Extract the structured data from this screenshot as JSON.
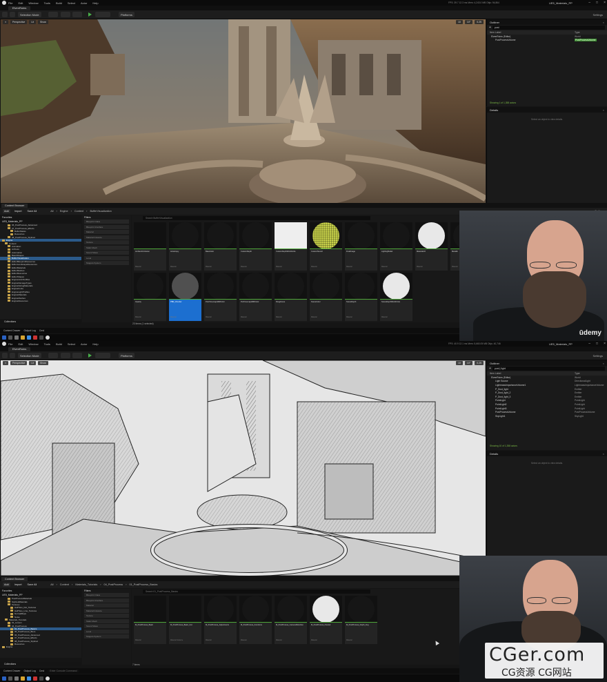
{
  "menu": {
    "items": [
      "File",
      "Edit",
      "Window",
      "Tools",
      "Build",
      "Select",
      "Actor",
      "Help"
    ],
    "project_name": "UE5_Materials_PP",
    "stats_top": "FPS: 39.7    12.3 ms    Mem: 4,243.0 MB    Objs: 94,864",
    "stats_bottom": "FPS: 40.9    12.1 ms    Mem: 5,660.05 MB    Objs: 40,746"
  },
  "level_tab": "ElvenRuins",
  "toolbar": {
    "mode": "Selection Mode",
    "platforms": "Platforms",
    "settings": "Settings"
  },
  "viewport": {
    "perspective": "Perspective",
    "lit": "Lit",
    "show": "Show",
    "grid_value": "10",
    "angle_value": "10°",
    "scale_value": "0.25"
  },
  "outliner_top": {
    "title": "Outliner",
    "search": "post",
    "col_label": "Item Label",
    "col_type": "Type",
    "rows": [
      {
        "label": "ElvenRuins (Editor)",
        "type": "World"
      },
      {
        "label": "PostProcessVolume",
        "type": "PostProcessVolume"
      }
    ],
    "footer": "Showing 1 of 1,358 actors"
  },
  "outliner_bottom": {
    "title": "Outliner",
    "search": "post | light",
    "col_label": "Item Label",
    "col_type": "Type",
    "rows": [
      {
        "label": "ElvenRuins (Editor)",
        "type": "World"
      },
      {
        "label": "Light Source",
        "type": "DirectionalLight"
      },
      {
        "label": "LightmassImportanceVolume1",
        "type": "LightmassImportanceVolume"
      },
      {
        "label": "P_Dust_light",
        "type": "Emitter"
      },
      {
        "label": "P_Dust_light_2",
        "type": "Emitter"
      },
      {
        "label": "P_Dust_light_3",
        "type": "Emitter"
      },
      {
        "label": "PointLight",
        "type": "PointLight"
      },
      {
        "label": "PointLight2",
        "type": "PointLight"
      },
      {
        "label": "PointLight3",
        "type": "PointLight"
      },
      {
        "label": "PostProcessVolume",
        "type": "PostProcessVolume"
      },
      {
        "label": "SkyLight1",
        "type": "SkyLight"
      }
    ],
    "footer": "Showing 10 of 1,358 actors"
  },
  "details": {
    "title": "Details",
    "empty": "Select an object to view details."
  },
  "content_browser_top": {
    "tab": "Content Browser",
    "add": "Add",
    "import": "Import",
    "save_all": "Save All",
    "breadcrumb": [
      "All",
      "Engine",
      "Content",
      "BufferVisualization"
    ],
    "settings": "Settings",
    "search_placeholder": "Search BufferVisualization",
    "filters_title": "Filters",
    "filters": [
      "Blueprint Class",
      "Blueprint Interface",
      "Material",
      "Material Instance",
      "Texture",
      "Static Mesh",
      "Sound Wave",
      "Level",
      "Niagara System"
    ],
    "sources": [
      {
        "label": "Favorites",
        "depth": 0,
        "head": true
      },
      {
        "label": "UE5_Materials_PP",
        "depth": 0,
        "head": true
      },
      {
        "label": "06_PostProcess_Advanced",
        "depth": 2
      },
      {
        "label": "07_PostProcess_Effects",
        "depth": 2
      },
      {
        "label": "BufferMasks",
        "depth": 3
      },
      {
        "label": "Resources",
        "depth": 3
      },
      {
        "label": "08_PostProcess_Stylized",
        "depth": 2
      },
      {
        "label": "Engine",
        "depth": 0,
        "sel": true
      },
      {
        "label": "Content",
        "depth": 1
      },
      {
        "label": "Animation",
        "depth": 2
      },
      {
        "label": "ArtTools",
        "depth": 2
      },
      {
        "label": "Automation",
        "depth": 2
      },
      {
        "label": "BasicShapes",
        "depth": 2
      },
      {
        "label": "BufferVisualization",
        "depth": 2,
        "sel": true
      },
      {
        "label": "EditorBlueprintResources",
        "depth": 2
      },
      {
        "label": "EditorLandscapeResources",
        "depth": 2
      },
      {
        "label": "EditorMaterials",
        "depth": 2
      },
      {
        "label": "EditorMeshes",
        "depth": 2
      },
      {
        "label": "EditorResources",
        "depth": 2
      },
      {
        "label": "EditorShapes",
        "depth": 2
      },
      {
        "label": "EngineAnimNotifies",
        "depth": 2
      },
      {
        "label": "EngineDamageTypes",
        "depth": 2
      },
      {
        "label": "EngineDebugMaterials",
        "depth": 2
      },
      {
        "label": "EngineFonts",
        "depth": 2
      },
      {
        "label": "EngineLightProfiles",
        "depth": 2
      },
      {
        "label": "EngineMaterials",
        "depth": 2
      },
      {
        "label": "EngineMeshes",
        "depth": 2
      },
      {
        "label": "EngineResources",
        "depth": 2
      }
    ],
    "assets": [
      {
        "name": "AmbientOcclusion",
        "kind": "Material"
      },
      {
        "name": "Anisotropy",
        "kind": "Material"
      },
      {
        "name": "BaseColor",
        "kind": "Material"
      },
      {
        "name": "CustomDepth",
        "kind": "Material"
      },
      {
        "name": "CustomDepthWorldUnits",
        "kind": "Material"
      },
      {
        "name": "CustomStencil",
        "kind": "Material"
      },
      {
        "name": "FinalImage",
        "kind": "Material"
      },
      {
        "name": "LightingModel",
        "kind": "Material"
      },
      {
        "name": "MaterialAO",
        "kind": "Material"
      },
      {
        "name": "Metallic",
        "kind": "Material"
      },
      {
        "name": "Opacity",
        "kind": "Material"
      },
      {
        "name": "PBR_Checker",
        "kind": "Material"
      },
      {
        "name": "PostTonemapHDRColor",
        "kind": "Material"
      },
      {
        "name": "PreTonemapHDRColor",
        "kind": "Material"
      },
      {
        "name": "Roughness",
        "kind": "Material"
      },
      {
        "name": "SceneColor",
        "kind": "Material"
      },
      {
        "name": "SceneDepth",
        "kind": "Material"
      },
      {
        "name": "SceneDepthWorldUnits",
        "kind": "Material"
      }
    ],
    "item_count": "23 items (1 selected)",
    "collections": "Collections"
  },
  "content_browser_bottom": {
    "tab": "Content Browser",
    "add": "Add",
    "import": "Import",
    "save_all": "Save All",
    "breadcrumb": [
      "All",
      "Content",
      "Materials_Tutorials",
      "04_PostProcess",
      "01_PostProcess_Basics"
    ],
    "settings": "Settings",
    "search_placeholder": "Search 01_PostProcess_Basics",
    "filters_title": "Filters",
    "filters": [
      "Blueprint Class",
      "Blueprint Interface",
      "Material",
      "Material Instance",
      "Texture",
      "Static Mesh",
      "Sound Wave",
      "Level",
      "Niagara System"
    ],
    "sources": [
      {
        "label": "Favorites",
        "depth": 0,
        "head": true
      },
      {
        "label": "UE5_Materials_PP",
        "depth": 0,
        "head": true
      },
      {
        "label": "PostProcessMaterials",
        "depth": 2
      },
      {
        "label": "StylizedMaterials",
        "depth": 2
      },
      {
        "label": "Textures",
        "depth": 2
      },
      {
        "label": "HalfTone_Dot_Textures",
        "depth": 3
      },
      {
        "label": "HalfTone_Line_Textures",
        "depth": 3
      },
      {
        "label": "NormalMaps",
        "depth": 3
      },
      {
        "label": "Noise",
        "depth": 3
      },
      {
        "label": "Materials_Tutorials",
        "depth": 1
      },
      {
        "label": "01_Lesson",
        "depth": 2
      },
      {
        "label": "04_PostProcess",
        "depth": 2
      },
      {
        "label": "01_PostProcess_Basics",
        "depth": 3,
        "sel": true
      },
      {
        "label": "05_PostProcess_Blurs",
        "depth": 3
      },
      {
        "label": "06_PostProcess_Advanced",
        "depth": 3
      },
      {
        "label": "07_PostProcess_Effects",
        "depth": 3
      },
      {
        "label": "08_PostProcess_Stylized",
        "depth": 3
      },
      {
        "label": "Resources",
        "depth": 3
      },
      {
        "label": "Engine",
        "depth": 0
      }
    ],
    "assets": [
      {
        "name": "M_PostProcess_Basic",
        "kind": "Material"
      },
      {
        "name": "M_PostProcess_Basic_Inst",
        "kind": "Material Instance"
      },
      {
        "name": "M_PostProcess_Adjustments",
        "kind": "Material"
      },
      {
        "name": "M_PostProcess_Functions",
        "kind": "Material"
      },
      {
        "name": "M_PostProcess_CameraDistortion",
        "kind": "Material"
      },
      {
        "name": "M_PostProcess_Fresnel",
        "kind": "Material"
      },
      {
        "name": "M_PostProcess_Depth_Fog",
        "kind": "Material"
      }
    ],
    "item_count": "7 items",
    "collections": "Collections"
  },
  "statusbar": {
    "content_drawer": "Content Drawer",
    "output_log": "Output Log",
    "cmd": "Cmd",
    "cmd_placeholder": "Enter Console Command",
    "derived_data": "Derived Data",
    "source_control": "Source Control Off"
  },
  "webcam": {
    "brand": "ūdemy"
  },
  "watermark": {
    "main": "CGer.com",
    "sub": "CG资源 CG网站"
  },
  "colors": {
    "accent_blue": "#1c6fd0",
    "play_green": "#49b04a",
    "asset_line_green": "#4fa83a",
    "folder_yellow": "#c9a44a"
  }
}
